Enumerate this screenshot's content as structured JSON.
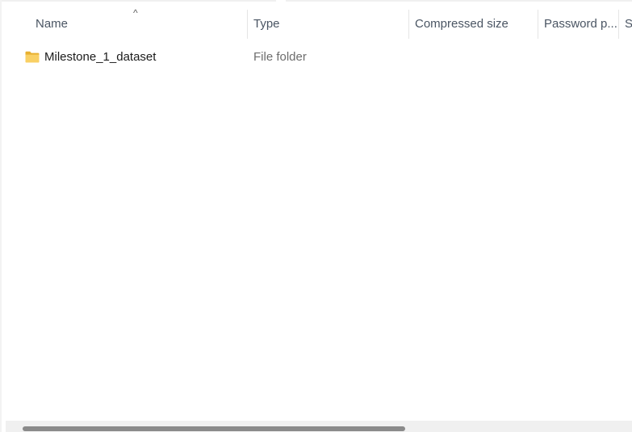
{
  "header": {
    "columns": [
      {
        "label": "Name"
      },
      {
        "label": "Type"
      },
      {
        "label": "Compressed size"
      },
      {
        "label": "Password p..."
      },
      {
        "label": "S"
      }
    ],
    "sort_indicator": "^"
  },
  "files": [
    {
      "name": "Milestone_1_dataset",
      "type": "File folder",
      "icon": "folder-icon"
    }
  ],
  "colors": {
    "folder": "#f6c94a",
    "scroll_thumb": "#8a8a8a"
  },
  "scrollbar": {
    "position": 0.0,
    "visible_fraction": 0.61
  }
}
